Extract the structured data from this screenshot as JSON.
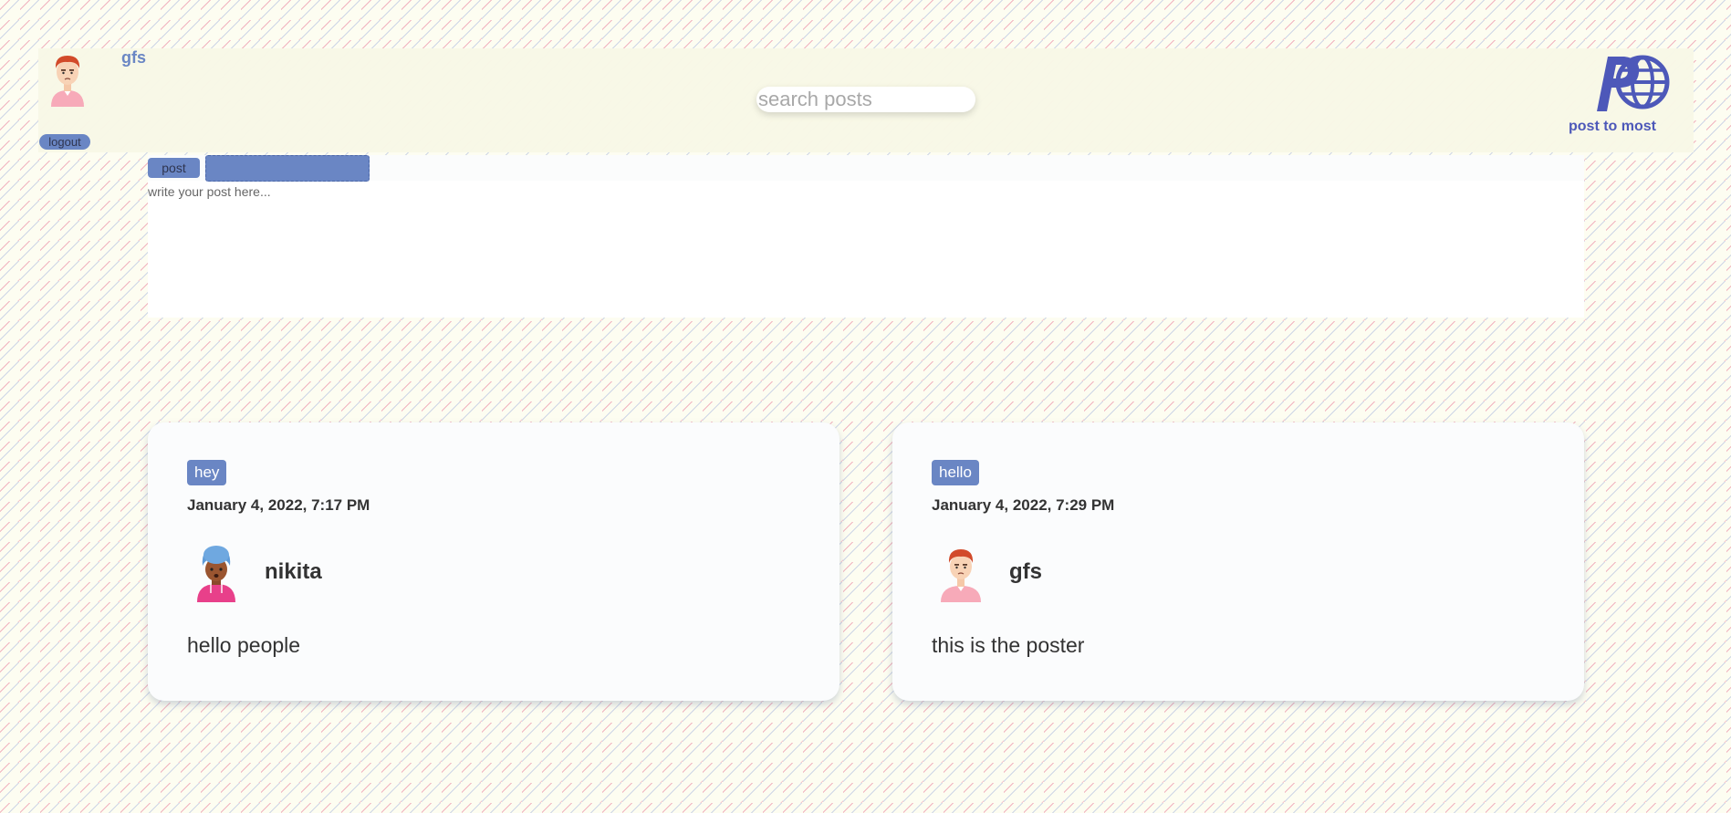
{
  "user": {
    "name": "gfs",
    "avatar": "man-red-hair-avatar"
  },
  "header": {
    "logout_label": "logout",
    "search_placeholder": "search posts",
    "logo_icon": "globe-logo-icon",
    "logo_text": "post to most"
  },
  "composer": {
    "post_label": "post",
    "title_value": "",
    "body_placeholder": "write your post here..."
  },
  "posts": [
    {
      "title": "hey",
      "date": "January 4, 2022, 7:17 PM",
      "author": "nikita",
      "avatar": "woman-blue-turban-avatar",
      "content": "hello people"
    },
    {
      "title": "hello",
      "date": "January 4, 2022, 7:29 PM",
      "author": "gfs",
      "avatar": "man-red-hair-avatar",
      "content": "this is the poster"
    }
  ],
  "colors": {
    "accent": "#6a86c4",
    "logo": "#4d58b9",
    "background": "#fdfdf1",
    "card": "#fbfcfd"
  }
}
